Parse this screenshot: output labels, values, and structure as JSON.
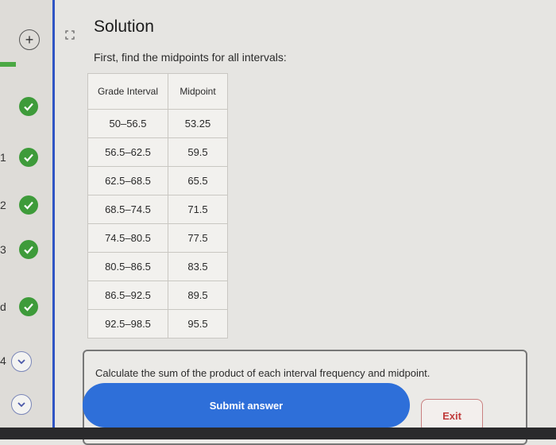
{
  "header": {
    "title": "Solution",
    "subtitle": "First, find the midpoints for all intervals:"
  },
  "sidebar": {
    "steps": [
      {
        "label": "",
        "state": "complete"
      },
      {
        "label": "1",
        "state": "complete"
      },
      {
        "label": "2",
        "state": "complete"
      },
      {
        "label": "3",
        "state": "complete"
      },
      {
        "label": "d",
        "state": "complete"
      },
      {
        "label": "4",
        "state": "collapsed"
      },
      {
        "label": "",
        "state": "collapsed"
      }
    ],
    "check_color": "#3e9b3a"
  },
  "table": {
    "headers": [
      "Grade Interval",
      "Midpoint"
    ],
    "rows": [
      [
        "50–56.5",
        "53.25"
      ],
      [
        "56.5–62.5",
        "59.5"
      ],
      [
        "62.5–68.5",
        "65.5"
      ],
      [
        "68.5–74.5",
        "71.5"
      ],
      [
        "74.5–80.5",
        "77.5"
      ],
      [
        "80.5–86.5",
        "83.5"
      ],
      [
        "86.5–92.5",
        "89.5"
      ],
      [
        "92.5–98.5",
        "95.5"
      ]
    ]
  },
  "prompt": {
    "text": "Calculate the sum of the product of each interval frequency and midpoint."
  },
  "actions": {
    "submit_label": "Submit answer",
    "exit_label": "Exit"
  },
  "colors": {
    "accent": "#2e6fd9",
    "exit": "#c03b3b",
    "sidebar_edge": "#2f54c4"
  }
}
